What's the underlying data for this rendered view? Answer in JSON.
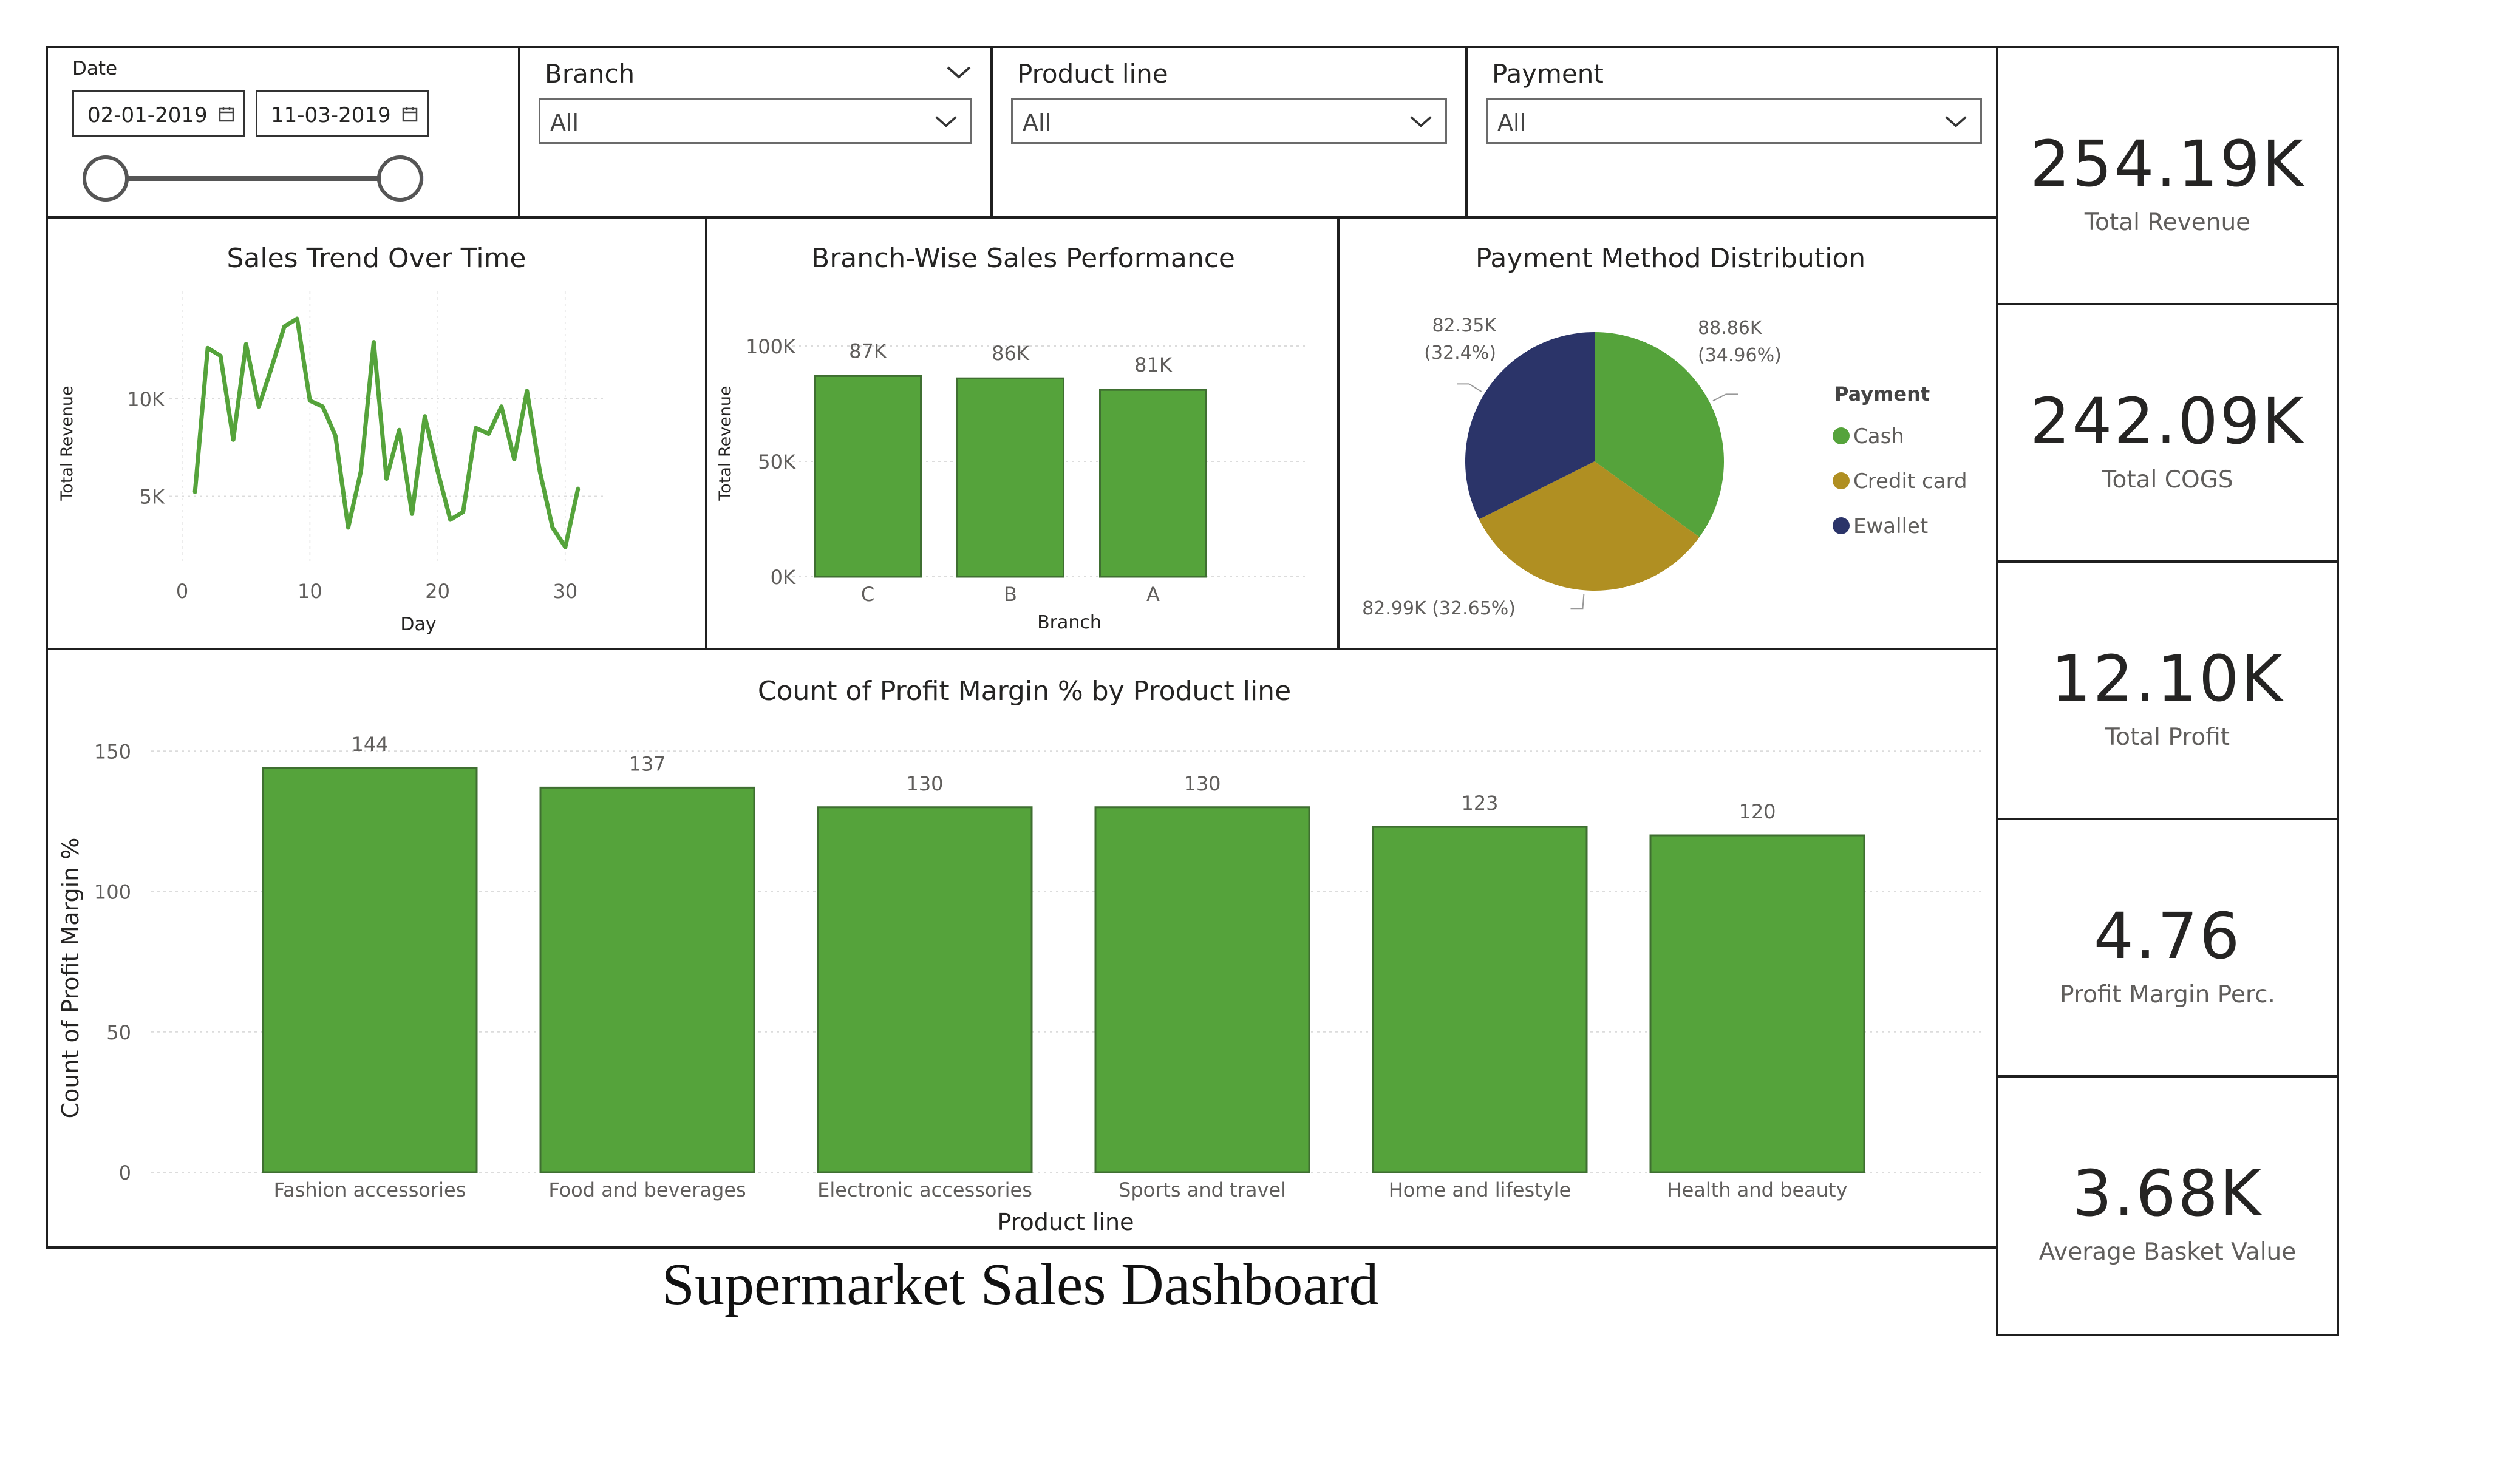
{
  "footer": {
    "title": "Supermarket Sales Dashboard"
  },
  "slicers": {
    "date": {
      "label": "Date",
      "start": "02-01-2019",
      "end": "11-03-2019",
      "start_icon": "calendar-icon",
      "end_icon": "calendar-icon"
    },
    "branch": {
      "label": "Branch",
      "value": "All"
    },
    "product_line": {
      "label": "Product line",
      "value": "All"
    },
    "payment": {
      "label": "Payment",
      "value": "All"
    }
  },
  "kpis": [
    {
      "value": "254.19K",
      "label": "Total Revenue"
    },
    {
      "value": "242.09K",
      "label": "Total COGS"
    },
    {
      "value": "12.10K",
      "label": "Total Profit"
    },
    {
      "value": "4.76",
      "label": "Profit Margin Perc."
    },
    {
      "value": "3.68K",
      "label": "Average Basket Value"
    }
  ],
  "colors": {
    "green": "#55a33b",
    "gold": "#b08f22",
    "navy": "#2b3469",
    "grid": "#dcdcdc",
    "axis_text": "#605e5c"
  },
  "chart_data": [
    {
      "id": "trend",
      "type": "line",
      "title": "Sales Trend Over Time",
      "xlabel": "Day",
      "ylabel": "Total Revenue",
      "xlim": [
        -1,
        33
      ],
      "ylim": [
        1500,
        15500
      ],
      "xticks": [
        0,
        10,
        20,
        30
      ],
      "yticks": [
        5000,
        10000
      ],
      "ytick_labels": [
        "5K",
        "10K"
      ],
      "x": [
        1,
        2,
        3,
        4,
        5,
        6,
        7,
        8,
        9,
        10,
        11,
        12,
        13,
        14,
        15,
        16,
        17,
        18,
        19,
        20,
        21,
        22,
        23,
        24,
        25,
        26,
        27,
        28,
        29,
        30,
        31
      ],
      "values": [
        5200,
        12600,
        12200,
        7900,
        12800,
        9600,
        11600,
        13700,
        14100,
        9900,
        9600,
        8100,
        3400,
        6300,
        12900,
        5900,
        8400,
        4100,
        9100,
        6300,
        3800,
        4200,
        8500,
        8200,
        9600,
        6900,
        10400,
        6300,
        3400,
        2400,
        5400
      ],
      "series_color": "#55a33b"
    },
    {
      "id": "branch",
      "type": "bar",
      "title": "Branch-Wise Sales Performance",
      "xlabel": "Branch",
      "ylabel": "Total Revenue",
      "categories": [
        "C",
        "B",
        "A"
      ],
      "values": [
        87000,
        86000,
        81000
      ],
      "data_labels": [
        "87K",
        "86K",
        "81K"
      ],
      "ylim": [
        0,
        100000
      ],
      "yticks": [
        0,
        50000,
        100000
      ],
      "ytick_labels": [
        "0K",
        "50K",
        "100K"
      ],
      "series_color": "#55a33b"
    },
    {
      "id": "payment",
      "type": "pie",
      "title": "Payment Method Distribution",
      "legend_title": "Payment",
      "legend_placement": "right",
      "slices": [
        {
          "name": "Cash",
          "value": 88860,
          "label": "88.86K",
          "pct": "(34.96%)",
          "color": "#55a33b"
        },
        {
          "name": "Credit card",
          "value": 82990,
          "label": "82.99K (32.65%)",
          "pct": "",
          "color": "#b08f22"
        },
        {
          "name": "Ewallet",
          "value": 82350,
          "label": "82.35K",
          "pct": "(32.4%)",
          "color": "#2b3469"
        }
      ]
    },
    {
      "id": "profit",
      "type": "bar",
      "title": "Count of Profit Margin % by Product line",
      "xlabel": "Product line",
      "ylabel": "Count of Profit Margin %",
      "categories": [
        "Fashion accessories",
        "Food and beverages",
        "Electronic accessories",
        "Sports and travel",
        "Home and lifestyle",
        "Health and beauty"
      ],
      "values": [
        144,
        137,
        130,
        130,
        123,
        120
      ],
      "ylim": [
        0,
        160
      ],
      "yticks": [
        0,
        50,
        100,
        150
      ],
      "series_color": "#55a33b"
    }
  ]
}
